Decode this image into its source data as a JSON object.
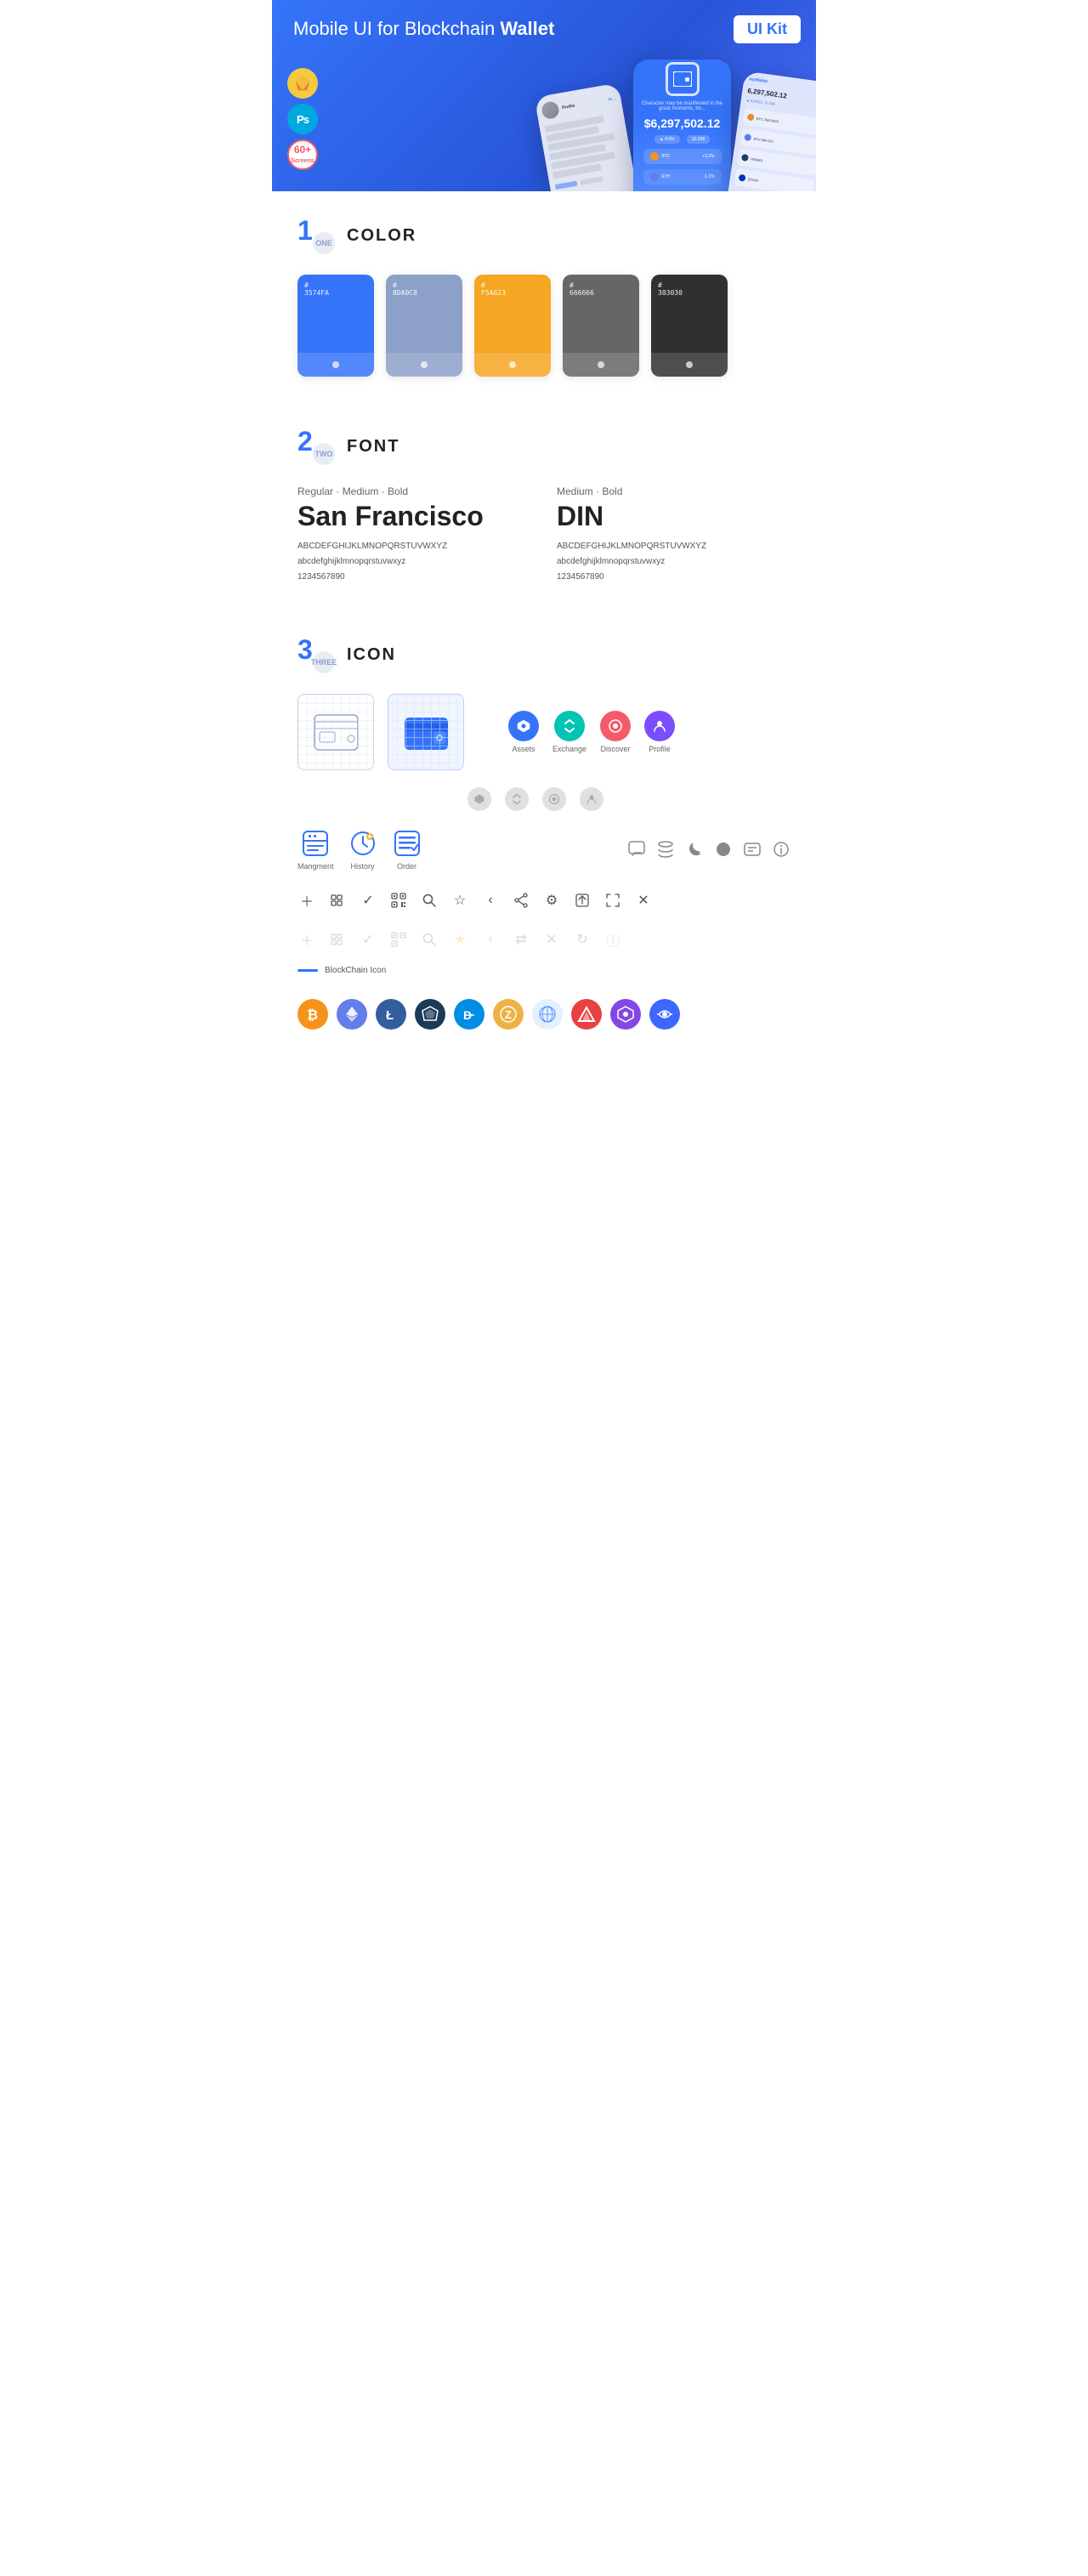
{
  "hero": {
    "title_normal": "Mobile UI for Blockchain ",
    "title_bold": "Wallet",
    "badge": "UI Kit",
    "tools": [
      "Sketch",
      "Ps",
      "60+\nScreens"
    ]
  },
  "sections": {
    "color": {
      "number": "1",
      "sub": "ONE",
      "title": "COLOR",
      "swatches": [
        {
          "hex": "#3574FA",
          "label": "3574FA",
          "dark": false
        },
        {
          "hex": "#8DA0C8",
          "label": "8DA0C8",
          "dark": false
        },
        {
          "hex": "#F5A623",
          "label": "F5A623",
          "dark": false
        },
        {
          "hex": "#666666",
          "label": "666666",
          "dark": false
        },
        {
          "hex": "#303030",
          "label": "303030",
          "dark": false
        }
      ]
    },
    "font": {
      "number": "2",
      "sub": "TWO",
      "title": "FONT",
      "fonts": [
        {
          "weights": "Regular · Medium · Bold",
          "name": "San Francisco",
          "uppercase": "ABCDEFGHIJKLMNOPQRSTUVWXYZ",
          "lowercase": "abcdefghijklmnopqrstuvwxyz",
          "numbers": "1234567890"
        },
        {
          "weights": "Medium · Bold",
          "name": "DIN",
          "uppercase": "ABCDEFGHIJKLMNOPQRSTUVWXYZ",
          "lowercase": "abcdefghijklmnopqrstuvwxyz",
          "numbers": "1234567890"
        }
      ]
    },
    "icon": {
      "number": "3",
      "sub": "THREE",
      "title": "ICON",
      "tab_icons": [
        {
          "label": "Assets"
        },
        {
          "label": "Exchange"
        },
        {
          "label": "Discover"
        },
        {
          "label": "Profile"
        }
      ],
      "bottom_icons": [
        {
          "label": "Mangment"
        },
        {
          "label": "History"
        },
        {
          "label": "Order"
        }
      ],
      "blockchain_label": "BlockChain Icon",
      "crypto_currencies": [
        {
          "symbol": "₿",
          "color": "#f7931a",
          "bg": "#fff4e5",
          "name": "Bitcoin"
        },
        {
          "symbol": "Ξ",
          "color": "#627eea",
          "bg": "#eef1fd",
          "name": "Ethereum"
        },
        {
          "symbol": "Ł",
          "color": "#345d9d",
          "bg": "#e8eef8",
          "name": "Litecoin"
        },
        {
          "symbol": "◈",
          "color": "#1b3a57",
          "bg": "#e8eef5",
          "name": "Stratis"
        },
        {
          "symbol": "D",
          "color": "#008de4",
          "bg": "#e5f4fd",
          "name": "Dash"
        },
        {
          "symbol": "Z",
          "color": "#ecb244",
          "bg": "#fdf5e5",
          "name": "Zcash"
        },
        {
          "symbol": "◎",
          "color": "#5f9ea0",
          "bg": "#e8f4f5",
          "name": "Loopring"
        },
        {
          "symbol": "▲",
          "color": "#e84142",
          "bg": "#fde8e8",
          "name": "Avalanche"
        },
        {
          "symbol": "◆",
          "color": "#c04fff",
          "bg": "#f5e8ff",
          "name": "Polygon"
        },
        {
          "symbol": "∞",
          "color": "#3d67ff",
          "bg": "#e8edff",
          "name": "Bancor"
        }
      ]
    }
  }
}
